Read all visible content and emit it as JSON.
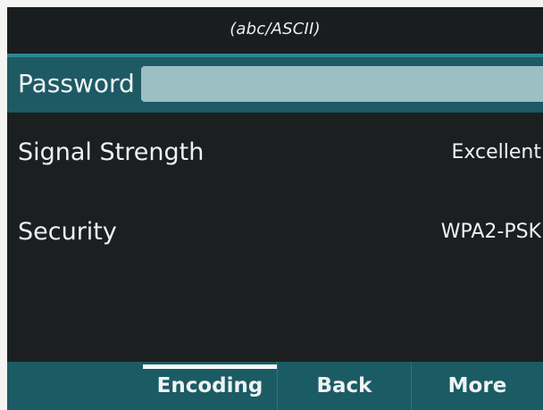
{
  "status_bar": {
    "input_mode": "(abc/ASCII)"
  },
  "password_row": {
    "label": "Password",
    "value": ""
  },
  "rows": [
    {
      "label": "Signal Strength",
      "value": "Excellent"
    },
    {
      "label": "Security",
      "value": "WPA2-PSK"
    }
  ],
  "softkeys": {
    "encoding": "Encoding",
    "back": "Back",
    "more": "More"
  },
  "colors": {
    "background": "#1c1f20",
    "highlight_row": "#1e5a64",
    "input_field": "#9bbfc3",
    "softkey_bar": "#1b5b64",
    "accent_line": "#2d8793"
  }
}
